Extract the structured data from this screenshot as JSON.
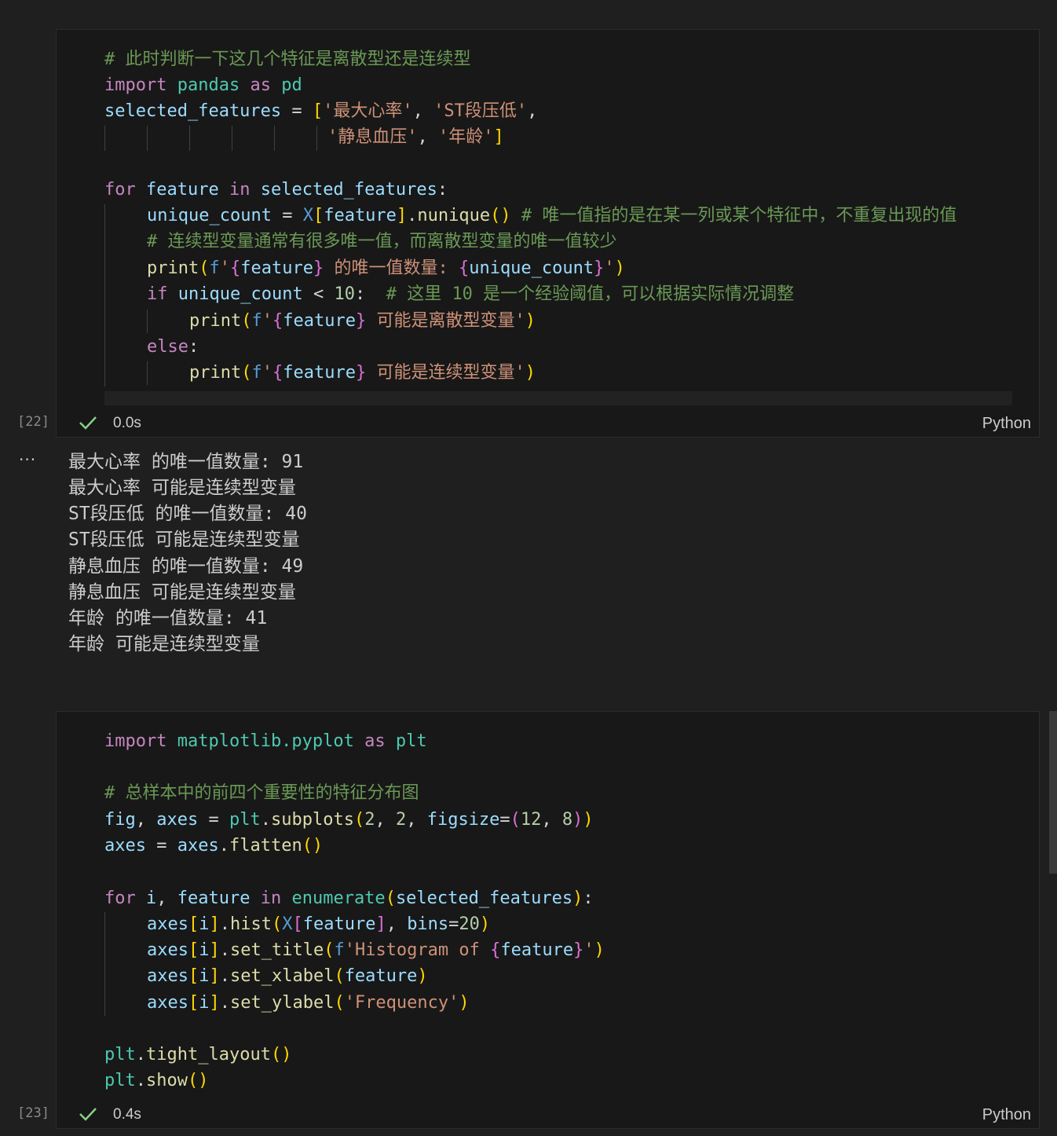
{
  "cell1": {
    "exec_count": "[22]",
    "duration": "0.0s",
    "language": "Python",
    "code": {
      "l1_comment": "# 此时判断一下这几个特征是离散型还是连续型",
      "l2_import": "import",
      "l2_module": "pandas",
      "l2_as": "as",
      "l2_alias": "pd",
      "l3_var": "selected_features",
      "l3_eq": " = ",
      "l3_open": "[",
      "l3_s1": "'最大心率'",
      "l3_comma1": ", ",
      "l3_s2": "'ST段压低'",
      "l3_comma2": ",",
      "l4_s3": "'静息血压'",
      "l4_comma": ", ",
      "l4_s4": "'年龄'",
      "l4_close": "]",
      "l6_for": "for",
      "l6_var": "feature",
      "l6_in": "in",
      "l6_iter": "selected_features",
      "l6_colon": ":",
      "l7_var": "unique_count",
      "l7_eq": " = ",
      "l7_x": "X",
      "l7_ob": "[",
      "l7_feat": "feature",
      "l7_cb": "]",
      "l7_dot": ".",
      "l7_fn": "nunique",
      "l7_paren": "()",
      "l7_comment": "# 唯一值指的是在某一列或某个特征中，不重复出现的值",
      "l8_comment": "# 连续型变量通常有很多唯一值，而离散型变量的唯一值较少",
      "l9_fn": "print",
      "l9_op": "(",
      "l9_f": "f",
      "l9_q1": "'",
      "l9_b1": "{",
      "l9_feat": "feature",
      "l9_b2": "}",
      "l9_text": " 的唯一值数量: ",
      "l9_b3": "{",
      "l9_var": "unique_count",
      "l9_b4": "}",
      "l9_q2": "'",
      "l9_cp": ")",
      "l10_if": "if",
      "l10_var": "unique_count",
      "l10_op": " < ",
      "l10_num": "10",
      "l10_colon": ":",
      "l10_comment": "# 这里 10 是一个经验阈值，可以根据实际情况调整",
      "l11_fn": "print",
      "l11_op": "(",
      "l11_f": "f",
      "l11_q1": "'",
      "l11_b1": "{",
      "l11_feat": "feature",
      "l11_b2": "}",
      "l11_text": " 可能是离散型变量'",
      "l11_cp": ")",
      "l12_else": "else",
      "l12_colon": ":",
      "l13_fn": "print",
      "l13_op": "(",
      "l13_f": "f",
      "l13_q1": "'",
      "l13_b1": "{",
      "l13_feat": "feature",
      "l13_b2": "}",
      "l13_text": " 可能是连续型变量'",
      "l13_cp": ")"
    }
  },
  "output": {
    "lines": [
      "最大心率 的唯一值数量: 91",
      "最大心率 可能是连续型变量",
      "ST段压低 的唯一值数量: 40",
      "ST段压低 可能是连续型变量",
      "静息血压 的唯一值数量: 49",
      "静息血压 可能是连续型变量",
      "年龄 的唯一值数量: 41",
      "年龄 可能是连续型变量"
    ]
  },
  "cell2": {
    "exec_count": "[23]",
    "duration": "0.4s",
    "language": "Python",
    "code": {
      "l1_import": "import",
      "l1_module": "matplotlib.pyplot",
      "l1_as": "as",
      "l1_alias": "plt",
      "l3_comment": "# 总样本中的前四个重要性的特征分布图",
      "l4_fig": "fig",
      "l4_comma": ", ",
      "l4_axes": "axes",
      "l4_eq": " = ",
      "l4_plt": "plt",
      "l4_dot": ".",
      "l4_fn": "subplots",
      "l4_op": "(",
      "l4_n1": "2",
      "l4_c1": ", ",
      "l4_n2": "2",
      "l4_c2": ", ",
      "l4_kw": "figsize",
      "l4_eq2": "=",
      "l4_op2": "(",
      "l4_n3": "12",
      "l4_c3": ", ",
      "l4_n4": "8",
      "l4_cp2": ")",
      "l4_cp": ")",
      "l5_axes": "axes",
      "l5_eq": " = ",
      "l5_axes2": "axes",
      "l5_dot": ".",
      "l5_fn": "flatten",
      "l5_paren": "()",
      "l7_for": "for",
      "l7_i": "i",
      "l7_comma": ", ",
      "l7_feat": "feature",
      "l7_in": "in",
      "l7_fn": "enumerate",
      "l7_op": "(",
      "l7_arg": "selected_features",
      "l7_cp": ")",
      "l7_colon": ":",
      "l8_axes": "axes",
      "l8_ob": "[",
      "l8_i": "i",
      "l8_cb": "]",
      "l8_dot": ".",
      "l8_fn": "hist",
      "l8_op": "(",
      "l8_x": "X",
      "l8_ob2": "[",
      "l8_feat": "feature",
      "l8_cb2": "]",
      "l8_comma": ", ",
      "l8_kw": "bins",
      "l8_eq": "=",
      "l8_num": "20",
      "l8_cp": ")",
      "l9_axes": "axes",
      "l9_ob": "[",
      "l9_i": "i",
      "l9_cb": "]",
      "l9_dot": ".",
      "l9_fn": "set_title",
      "l9_op": "(",
      "l9_f": "f",
      "l9_str": "'Histogram of ",
      "l9_b1": "{",
      "l9_feat": "feature",
      "l9_b2": "}",
      "l9_q2": "'",
      "l9_cp": ")",
      "l10_axes": "axes",
      "l10_ob": "[",
      "l10_i": "i",
      "l10_cb": "]",
      "l10_dot": ".",
      "l10_fn": "set_xlabel",
      "l10_op": "(",
      "l10_feat": "feature",
      "l10_cp": ")",
      "l11_axes": "axes",
      "l11_ob": "[",
      "l11_i": "i",
      "l11_cb": "]",
      "l11_dot": ".",
      "l11_fn": "set_ylabel",
      "l11_op": "(",
      "l11_str": "'Frequency'",
      "l11_cp": ")",
      "l13_plt": "plt",
      "l13_dot": ".",
      "l13_fn": "tight_layout",
      "l13_paren": "()",
      "l14_plt": "plt",
      "l14_dot": ".",
      "l14_fn": "show",
      "l14_paren": "()"
    }
  },
  "icons": {
    "check": "check-icon",
    "more": "more-icon"
  },
  "colors": {
    "success": "#89d185",
    "keyword": "#c586c0",
    "module": "#4ec9b0",
    "string": "#ce9178",
    "comment": "#6a9955"
  }
}
